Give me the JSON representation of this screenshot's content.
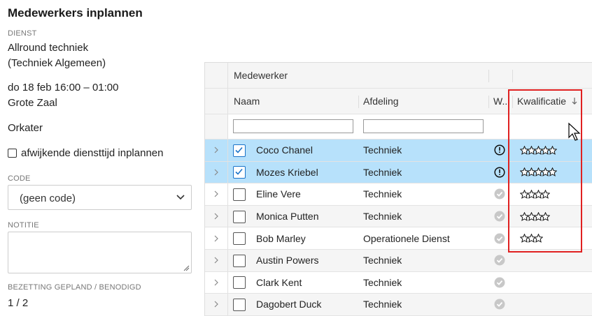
{
  "title": "Medewerkers inplannen",
  "dienst": {
    "label": "DIENST",
    "line1": "Allround techniek",
    "line2": "(Techniek Algemeen)"
  },
  "datetime": {
    "line1": "do 18 feb 16:00 – 01:00",
    "line2": "Grote Zaal"
  },
  "venue": "Orkater",
  "afwijkend_label": "afwijkende diensttijd inplannen",
  "code": {
    "label": "CODE",
    "value": "(geen code)"
  },
  "notitie": {
    "label": "NOTITIE"
  },
  "bezetting": {
    "label": "BEZETTING GEPLAND / BENODIGD",
    "value": "1 / 2"
  },
  "grid": {
    "group_header": "Medewerker",
    "columns": {
      "naam": "Naam",
      "afdeling": "Afdeling",
      "w": "W...",
      "kwalificatie": "Kwalificatie"
    },
    "rows": [
      {
        "naam": "Coco Chanel",
        "afdeling": "Techniek",
        "checked": true,
        "status": "warning",
        "stars": 5
      },
      {
        "naam": "Mozes Kriebel",
        "afdeling": "Techniek",
        "checked": true,
        "status": "warning",
        "stars": 5
      },
      {
        "naam": "Eline Vere",
        "afdeling": "Techniek",
        "checked": false,
        "status": "ok",
        "stars": 4
      },
      {
        "naam": "Monica Putten",
        "afdeling": "Techniek",
        "checked": false,
        "status": "ok",
        "stars": 4
      },
      {
        "naam": "Bob Marley",
        "afdeling": "Operationele Dienst",
        "checked": false,
        "status": "ok",
        "stars": 3
      },
      {
        "naam": "Austin Powers",
        "afdeling": "Techniek",
        "checked": false,
        "status": "ok",
        "stars": 0
      },
      {
        "naam": "Clark Kent",
        "afdeling": "Techniek",
        "checked": false,
        "status": "ok",
        "stars": 0
      },
      {
        "naam": "Dagobert Duck",
        "afdeling": "Techniek",
        "checked": false,
        "status": "ok",
        "stars": 0
      }
    ]
  },
  "colors": {
    "selected_row": "#b7e1fb",
    "highlight_box": "#e02020",
    "check_blue": "#1a73c8"
  }
}
